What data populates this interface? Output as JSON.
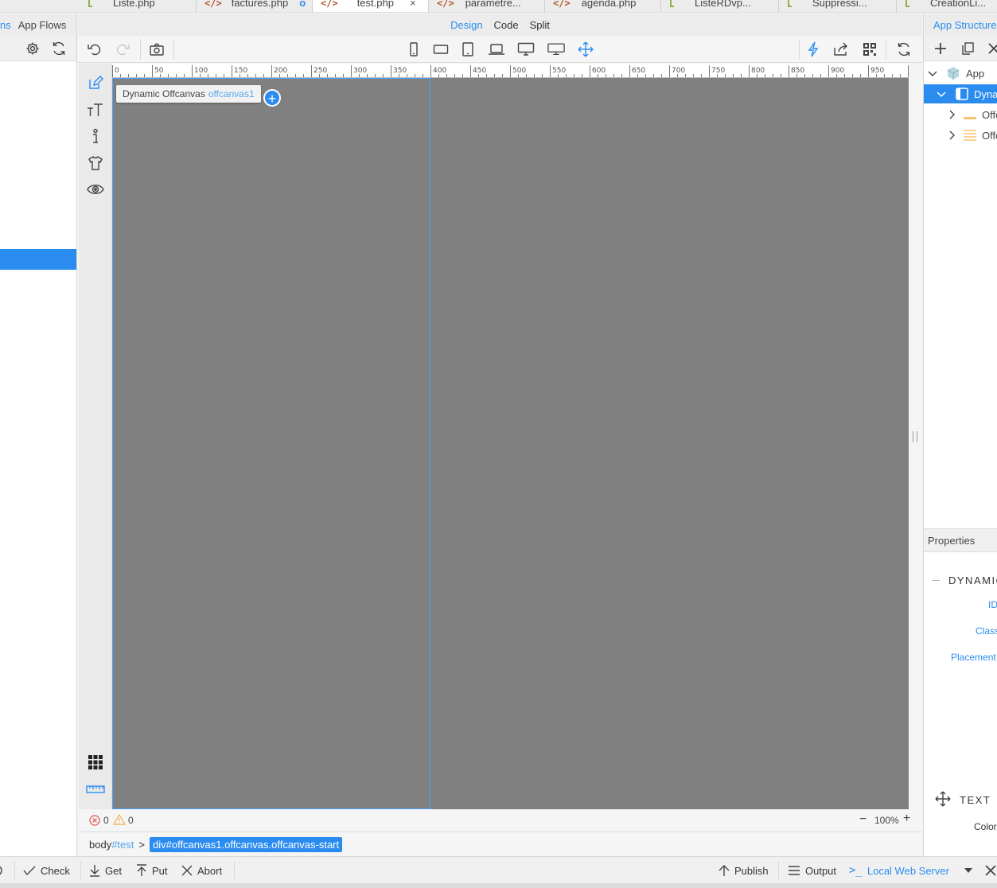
{
  "file_tabs": [
    {
      "label": "Liste.php",
      "icon": "flow-file-icon"
    },
    {
      "label": "factures.php",
      "icon": "code-icon",
      "modified": "o"
    },
    {
      "label": "test.php",
      "icon": "code-icon",
      "active": true,
      "close": "×"
    },
    {
      "label": "parametre...",
      "icon": "code-icon"
    },
    {
      "label": "agenda.php",
      "icon": "code-icon"
    },
    {
      "label": "ListeRDvp...",
      "icon": "flow-file-icon"
    },
    {
      "label": "Suppressi...",
      "icon": "flow-file-icon"
    },
    {
      "label": "CreationLi...",
      "icon": "flow-file-icon"
    }
  ],
  "left_panel": {
    "tab1": "ns",
    "tab2": "App Flows"
  },
  "view_tabs": {
    "design": "Design",
    "code": "Code",
    "split": "Split"
  },
  "canvas": {
    "element_label": "Dynamic Offcanvas",
    "element_id": "offcanvas1",
    "add_symbol": "+",
    "bg_color": "#808080",
    "ruler_ticks": [
      "0",
      "50",
      "100",
      "150",
      "200",
      "250",
      "300",
      "350",
      "400",
      "450",
      "500",
      "550",
      "600",
      "650",
      "700",
      "750",
      "800",
      "850",
      "900",
      "950"
    ]
  },
  "status": {
    "errors": "0",
    "warnings": "0",
    "zoom": "100%",
    "zoom_out": "−",
    "zoom_in": "+"
  },
  "breadcrumb": {
    "body_tag": "body",
    "body_id": "#test",
    "sep": ">",
    "active": "div#offcanvas1.offcanvas.offcanvas-start"
  },
  "right_panel": {
    "tab": "App Structure",
    "tree": [
      {
        "label": "App"
      },
      {
        "label": "Dynamic"
      },
      {
        "label": "Offcanvas"
      },
      {
        "label": "Offcanvas"
      }
    ],
    "properties_title": "Properties",
    "section": "DYNAMIC",
    "prop_id": "ID",
    "prop_class": "Class",
    "prop_placement": "Placement",
    "text_section": "TEXT",
    "prop_color": "Color"
  },
  "bottom_bar": {
    "check": "Check",
    "get": "Get",
    "put": "Put",
    "abort": "Abort",
    "publish": "Publish",
    "output": "Output",
    "server": "Local Web Server",
    "server_prompt": ">_"
  },
  "colors": {
    "accent": "#2b8cf0",
    "code_icon": "#b5562b",
    "flow_icon": "#8fb04a"
  }
}
